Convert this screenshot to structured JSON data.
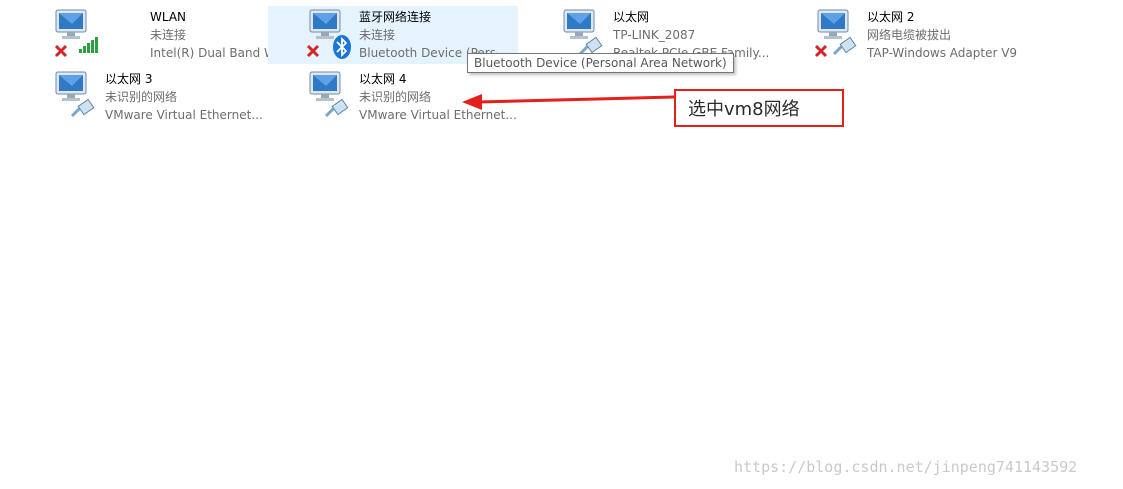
{
  "adapters": [
    {
      "name": "WLAN",
      "status": "未连接",
      "device": "Intel(R) Dual Band Wirel...",
      "kind": "wifi",
      "disconnected": true,
      "selected": false
    },
    {
      "name": "蓝牙网络连接",
      "status": "未连接",
      "device": "Bluetooth Device (Perso",
      "kind": "bluetooth",
      "disconnected": true,
      "selected": true
    },
    {
      "name": "以太网",
      "status": "TP-LINK_2087",
      "device": "Realtek PCIe GBE Family...",
      "kind": "ethernet",
      "disconnected": false,
      "selected": false
    },
    {
      "name": "以太网 2",
      "status": "网络电缆被拔出",
      "device": "TAP-Windows Adapter V9",
      "kind": "ethernet",
      "disconnected": true,
      "selected": false
    },
    {
      "name": "以太网 3",
      "status": "未识别的网络",
      "device": "VMware Virtual Ethernet...",
      "kind": "ethernet",
      "disconnected": false,
      "selected": false
    },
    {
      "name": "以太网 4",
      "status": "未识别的网络",
      "device": "VMware Virtual Ethernet...",
      "kind": "ethernet",
      "disconnected": false,
      "selected": false
    }
  ],
  "tooltip": "Bluetooth Device (Personal Area Network)",
  "annotation": "选中vm8网络",
  "watermark": "https://blog.csdn.net/jinpeng741143592",
  "colors": {
    "selected_bg": "#e5f3ff",
    "annotation_red": "#e3201b",
    "monitor_blue": "#2f79c7",
    "error_red": "#d4262a",
    "signal_green": "#2ea043",
    "bluetooth_blue": "#1b74d6"
  }
}
